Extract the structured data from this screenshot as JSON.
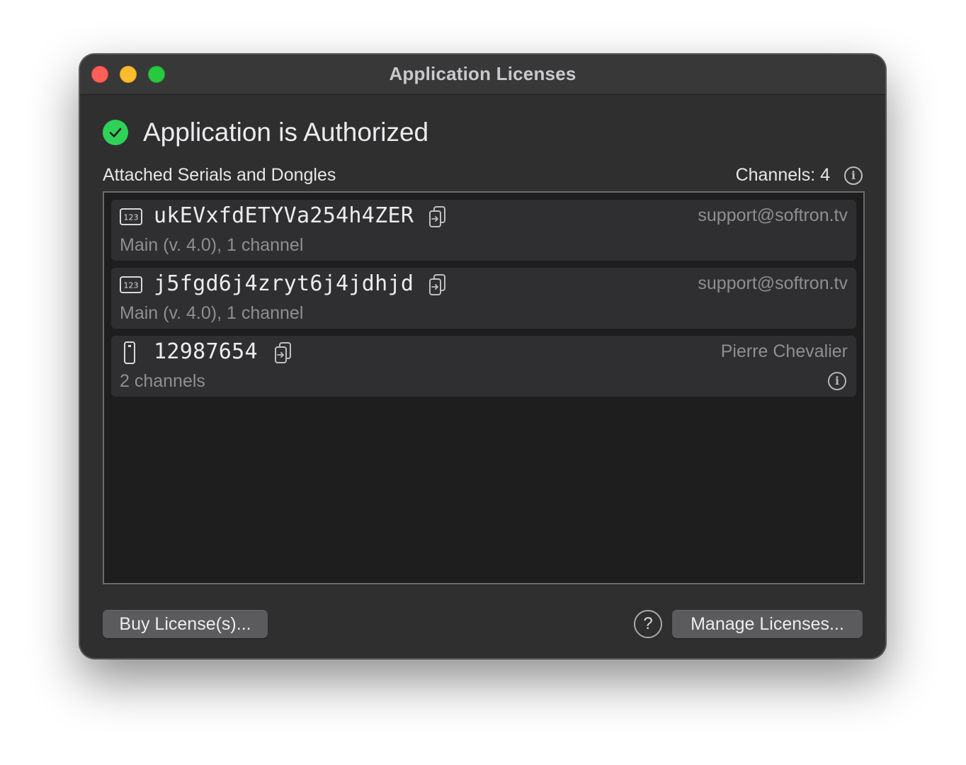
{
  "window": {
    "title": "Application Licenses"
  },
  "status": {
    "title": "Application is Authorized",
    "icon": "checkmark-circle-icon",
    "color": "#30d158"
  },
  "section": {
    "label": "Attached Serials and Dongles",
    "channels": "Channels: 4"
  },
  "licenses": [
    {
      "type": "serial",
      "icon": "serial-number-icon",
      "key": "ukEVxfdETYVa254h4ZER",
      "owner": "support@softron.tv",
      "description": "Main (v. 4.0), 1 channel"
    },
    {
      "type": "serial",
      "icon": "serial-number-icon",
      "key": "j5fgd6j4zryt6j4jdhjd",
      "owner": "support@softron.tv",
      "description": "Main (v. 4.0), 1 channel"
    },
    {
      "type": "dongle",
      "icon": "usb-dongle-icon",
      "key": "12987654",
      "owner": "Pierre Chevalier",
      "description": "2 channels"
    }
  ],
  "buttons": {
    "buy": "Buy License(s)...",
    "help": "?",
    "manage": "Manage Licenses..."
  }
}
